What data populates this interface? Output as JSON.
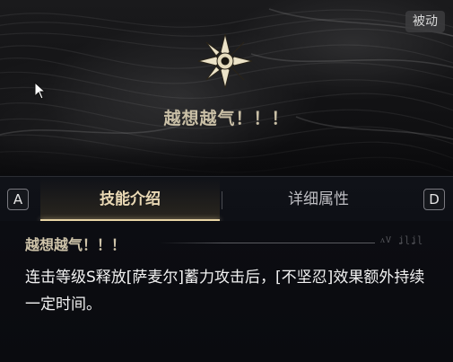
{
  "skill": {
    "name": "越想越气！！！",
    "type_badge": "被动",
    "icon": "compass-star-icon"
  },
  "tabs": {
    "left_key": "A",
    "right_key": "D",
    "items": [
      {
        "label": "技能介绍",
        "active": true
      },
      {
        "label": "详细属性",
        "active": false
      }
    ]
  },
  "description": {
    "title": "越想越气！！！",
    "deco_text": "ᴧV ʝɭʝɭ",
    "body": "连击等级S释放[萨麦尔]蓄力攻击后，[不坚忍]效果额外持续一定时间。"
  },
  "colors": {
    "accent_gold": "#e8d4a4",
    "title_text": "#c9bfa6"
  }
}
